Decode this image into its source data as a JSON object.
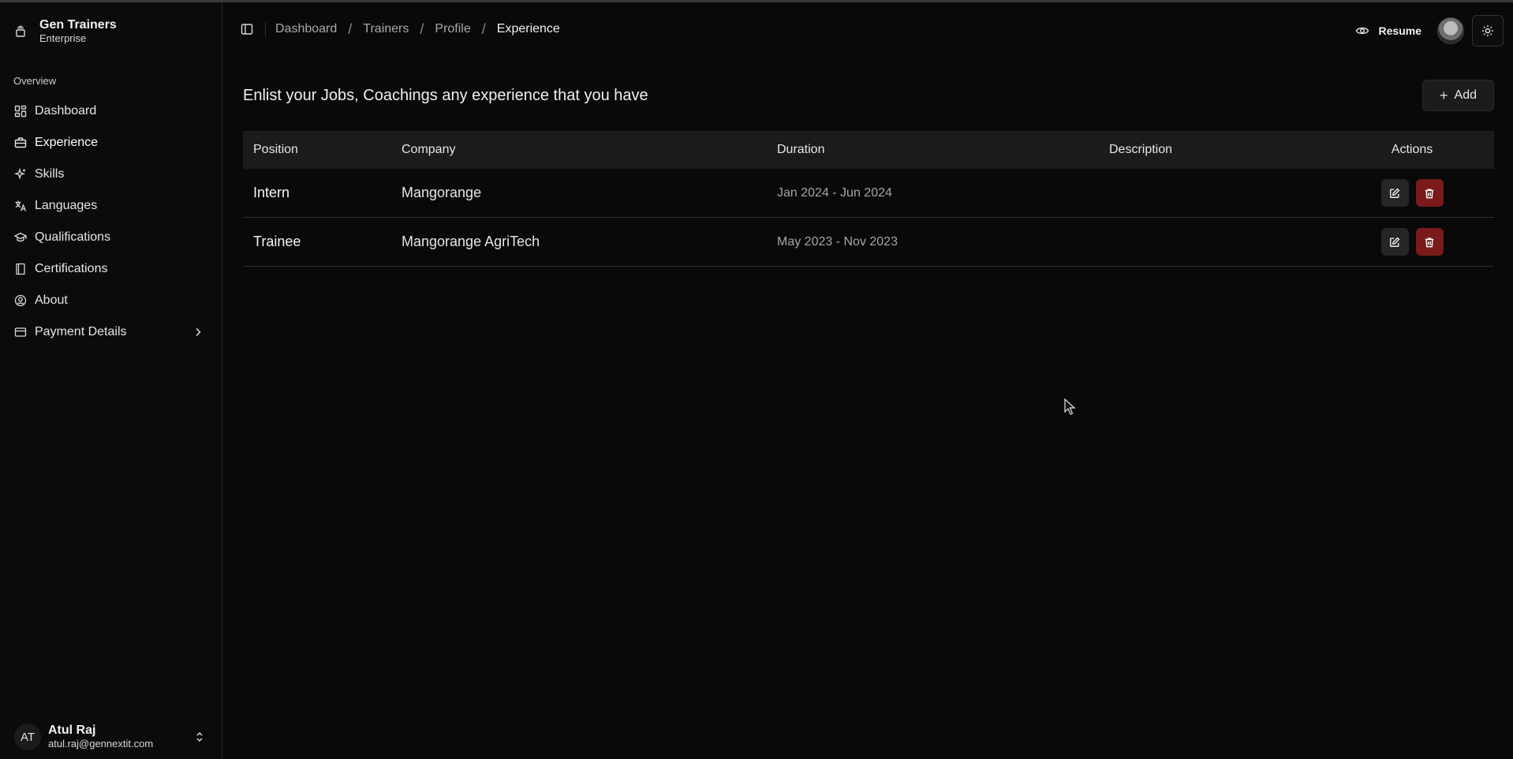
{
  "brand": {
    "title": "Gen Trainers",
    "subtitle": "Enterprise",
    "icon": "layers-icon"
  },
  "sidebar": {
    "section_label": "Overview",
    "items": [
      {
        "label": "Dashboard",
        "icon": "grid-icon"
      },
      {
        "label": "Experience",
        "icon": "briefcase-icon"
      },
      {
        "label": "Skills",
        "icon": "sparkles-icon"
      },
      {
        "label": "Languages",
        "icon": "translate-icon"
      },
      {
        "label": "Qualifications",
        "icon": "graduation-cap-icon"
      },
      {
        "label": "Certifications",
        "icon": "book-icon"
      },
      {
        "label": "About",
        "icon": "user-circle-icon"
      },
      {
        "label": "Payment Details",
        "icon": "credit-card-icon"
      }
    ]
  },
  "user": {
    "initials": "AT",
    "name": "Atul Raj",
    "email": "atul.raj@gennextit.com"
  },
  "header": {
    "breadcrumbs": [
      "Dashboard",
      "Trainers",
      "Profile",
      "Experience"
    ],
    "resume_label": "Resume"
  },
  "page": {
    "title": "Enlist your Jobs, Coachings any experience that you have",
    "add_label": "Add"
  },
  "table": {
    "columns": [
      "Position",
      "Company",
      "Duration",
      "Description",
      "Actions"
    ],
    "rows": [
      {
        "position": "Intern",
        "company": "Mangorange",
        "duration": "Jan 2024 - Jun 2024",
        "description": ""
      },
      {
        "position": "Trainee",
        "company": "Mangorange AgriTech",
        "duration": "May 2023 - Nov 2023",
        "description": ""
      }
    ]
  },
  "colors": {
    "background": "#090909",
    "delete": "#7a1a1a",
    "header_row": "#1b1b1b"
  }
}
